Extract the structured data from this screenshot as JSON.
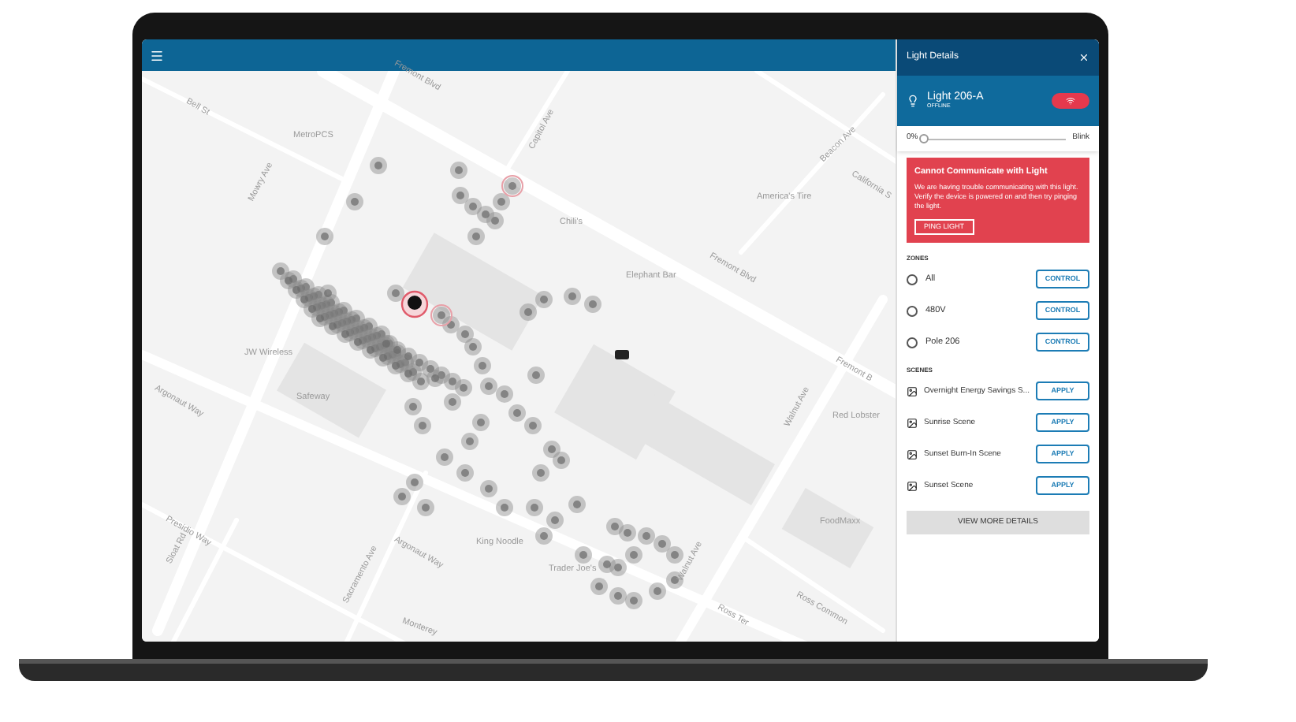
{
  "map": {
    "labels": [
      {
        "text": "Bell St"
      },
      {
        "text": "Fremont Blvd"
      },
      {
        "text": "MetroPCS"
      },
      {
        "text": "Mowry Ave"
      },
      {
        "text": "Capitol Ave"
      },
      {
        "text": "Chili's"
      },
      {
        "text": "America's Tire"
      },
      {
        "text": "Beacon Ave"
      },
      {
        "text": "California S"
      },
      {
        "text": "Fremont Blvd"
      },
      {
        "text": "Elephant Bar"
      },
      {
        "text": "Fremont B"
      },
      {
        "text": "JW Wireless"
      },
      {
        "text": "Safeway"
      },
      {
        "text": "Argonaut Way"
      },
      {
        "text": "Walnut Ave"
      },
      {
        "text": "Red Lobster"
      },
      {
        "text": "Presidio Way"
      },
      {
        "text": "Argonaut Way"
      },
      {
        "text": "King Noodle"
      },
      {
        "text": "Sloat Rd"
      },
      {
        "text": "Trader Joe's"
      },
      {
        "text": "FoodMaxx"
      },
      {
        "text": "Walnut Ave"
      },
      {
        "text": "Sacramento Ave"
      },
      {
        "text": "Ross Common"
      },
      {
        "text": "Ross Ter"
      },
      {
        "text": "Monterey"
      }
    ]
  },
  "panel": {
    "title": "Light Details",
    "light": {
      "name": "Light 206-A",
      "status": "OFFLINE"
    },
    "slider": {
      "min_label": "0%",
      "max_label": "Blink",
      "level": 0.0
    },
    "alert": {
      "title": "Cannot Communicate with Light",
      "message": "We are having trouble communicating with this light. Verify the device is powered on and then try pinging the light.",
      "button": "PING LIGHT"
    },
    "zones": {
      "heading": "ZONES",
      "items": [
        {
          "name": "All",
          "button": "CONTROL"
        },
        {
          "name": "480V",
          "button": "CONTROL"
        },
        {
          "name": "Pole 206",
          "button": "CONTROL"
        }
      ]
    },
    "scenes": {
      "heading": "SCENES",
      "items": [
        {
          "name": "Overnight Energy Savings S...",
          "button": "APPLY"
        },
        {
          "name": "Sunrise Scene",
          "button": "APPLY"
        },
        {
          "name": "Sunset Burn-In Scene",
          "button": "APPLY"
        },
        {
          "name": "Sunset Scene",
          "button": "APPLY"
        }
      ]
    },
    "view_more": "VIEW MORE DETAILS"
  }
}
